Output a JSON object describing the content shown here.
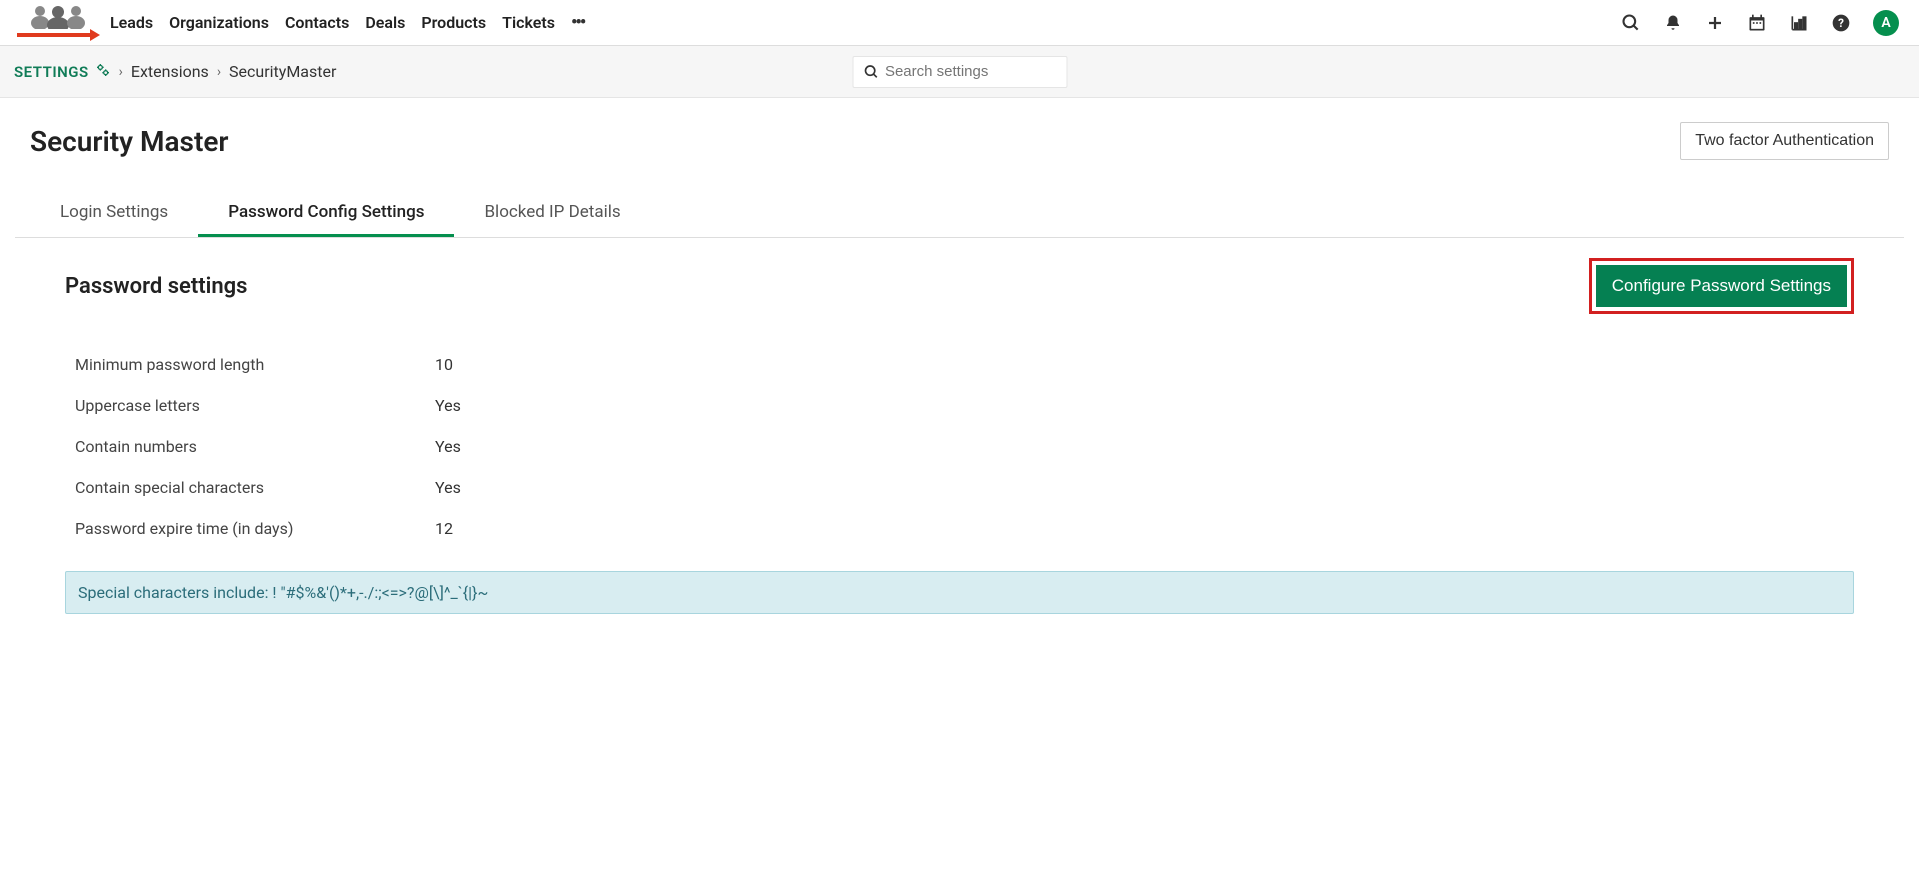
{
  "nav": {
    "items": [
      "Leads",
      "Organizations",
      "Contacts",
      "Deals",
      "Products",
      "Tickets"
    ],
    "avatar_letter": "A"
  },
  "breadcrumb": {
    "settings_label": "SETTINGS",
    "items": [
      "Extensions",
      "SecurityMaster"
    ]
  },
  "search": {
    "placeholder": "Search settings"
  },
  "page": {
    "title": "Security Master",
    "tfa_button": "Two factor Authentication"
  },
  "tabs": [
    {
      "label": "Login Settings",
      "active": false
    },
    {
      "label": "Password Config Settings",
      "active": true
    },
    {
      "label": "Blocked IP Details",
      "active": false
    }
  ],
  "section": {
    "title": "Password settings",
    "configure_button": "Configure Password Settings"
  },
  "settings": [
    {
      "label": "Minimum password length",
      "value": "10"
    },
    {
      "label": "Uppercase letters",
      "value": "Yes"
    },
    {
      "label": "Contain numbers",
      "value": "Yes"
    },
    {
      "label": "Contain special characters",
      "value": "Yes"
    },
    {
      "label": "Password expire time (in days)",
      "value": "12"
    }
  ],
  "info_text": "Special characters include: ! \"#$%&'()*+,-./:;<=>?@[\\]^_`{|}~"
}
